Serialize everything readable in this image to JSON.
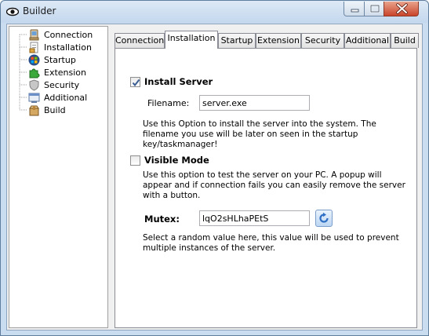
{
  "window": {
    "title": "Builder"
  },
  "sidebar": {
    "items": [
      {
        "label": "Connection",
        "icon": "connection-icon"
      },
      {
        "label": "Installation",
        "icon": "installation-icon"
      },
      {
        "label": "Startup",
        "icon": "startup-icon"
      },
      {
        "label": "Extension",
        "icon": "extension-icon"
      },
      {
        "label": "Security",
        "icon": "security-icon"
      },
      {
        "label": "Additional",
        "icon": "additional-icon"
      },
      {
        "label": "Build",
        "icon": "build-icon"
      }
    ]
  },
  "tabs": [
    "Connection",
    "Installation",
    "Startup",
    "Extension",
    "Security",
    "Additional",
    "Build"
  ],
  "active_tab": "Installation",
  "install": {
    "checkbox_label": "Install Server",
    "checked": true,
    "filename_label": "Filename:",
    "filename_value": "server.exe",
    "description": "Use this Option to install the server into the system. The filename you use will be later on seen in the startup key/taskmanager!"
  },
  "visible": {
    "checkbox_label": "Visible Mode",
    "checked": false,
    "description": "Use this option to test the server on your PC. A popup will appear and if connection fails you can easily remove the server with a button."
  },
  "mutex": {
    "label": "Mutex:",
    "value": "lqO2sHLhaPEtS",
    "description": "Select a random value here, this value will be used to prevent multiple instances of the server."
  },
  "colors": {
    "title_bar": "#c9dcf0",
    "close_button": "#c9452c",
    "panel": "#ffffff"
  }
}
